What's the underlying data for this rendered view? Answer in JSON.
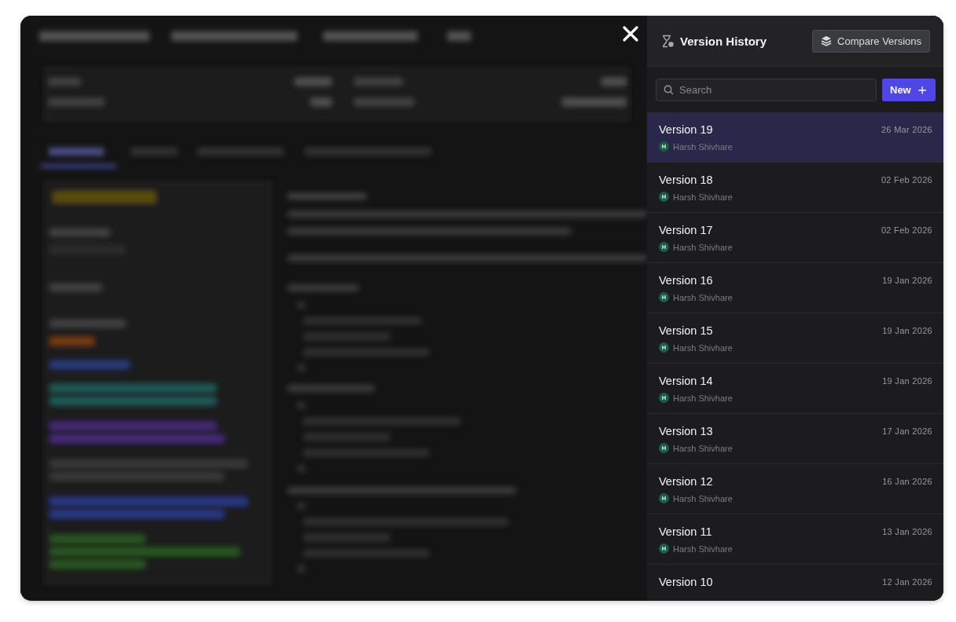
{
  "drawer": {
    "title": "Version History",
    "compare_button": "Compare Versions",
    "search": {
      "placeholder": "Search"
    },
    "new_button": "New",
    "versions": [
      {
        "name": "Version 19",
        "date": "26 Mar 2026",
        "author": "Harsh Shivhare",
        "initial": "H",
        "selected": true
      },
      {
        "name": "Version 18",
        "date": "02 Feb 2026",
        "author": "Harsh Shivhare",
        "initial": "H",
        "selected": false
      },
      {
        "name": "Version 17",
        "date": "02 Feb 2026",
        "author": "Harsh Shivhare",
        "initial": "H",
        "selected": false
      },
      {
        "name": "Version 16",
        "date": "19 Jan 2026",
        "author": "Harsh Shivhare",
        "initial": "H",
        "selected": false
      },
      {
        "name": "Version 15",
        "date": "19 Jan 2026",
        "author": "Harsh Shivhare",
        "initial": "H",
        "selected": false
      },
      {
        "name": "Version 14",
        "date": "19 Jan 2026",
        "author": "Harsh Shivhare",
        "initial": "H",
        "selected": false
      },
      {
        "name": "Version 13",
        "date": "17 Jan 2026",
        "author": "Harsh Shivhare",
        "initial": "H",
        "selected": false
      },
      {
        "name": "Version 12",
        "date": "16 Jan 2026",
        "author": "Harsh Shivhare",
        "initial": "H",
        "selected": false
      },
      {
        "name": "Version 11",
        "date": "13 Jan 2026",
        "author": "Harsh Shivhare",
        "initial": "H",
        "selected": false
      },
      {
        "name": "Version 10",
        "date": "12 Jan 2026",
        "selected": false
      }
    ]
  }
}
